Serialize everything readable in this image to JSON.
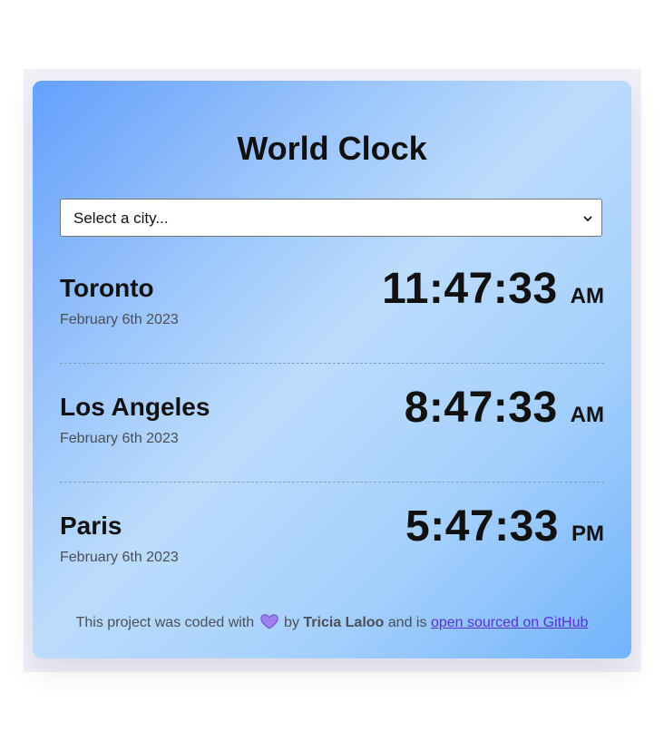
{
  "title": "World Clock",
  "select": {
    "selected_label": "Select a city..."
  },
  "cities": [
    {
      "name": "Toronto",
      "date": "February 6th 2023",
      "time": "11:47:33",
      "ampm": "AM"
    },
    {
      "name": "Los Angeles",
      "date": "February 6th 2023",
      "time": "8:47:33",
      "ampm": "AM"
    },
    {
      "name": "Paris",
      "date": "February 6th 2023",
      "time": "5:47:33",
      "ampm": "PM"
    }
  ],
  "footer": {
    "prefix": "This project was coded with",
    "heart_icon": "purple-heart-icon",
    "by_text": "by",
    "author": "Tricia Laloo",
    "middle": "and is",
    "link_text": "open sourced on GitHub"
  },
  "colors": {
    "gradient_start": "#64a0fc",
    "gradient_mid": "#bcdcfc",
    "gradient_end": "#72b4fc",
    "link": "#5b2fd6",
    "heart": "#9d7ff0"
  }
}
